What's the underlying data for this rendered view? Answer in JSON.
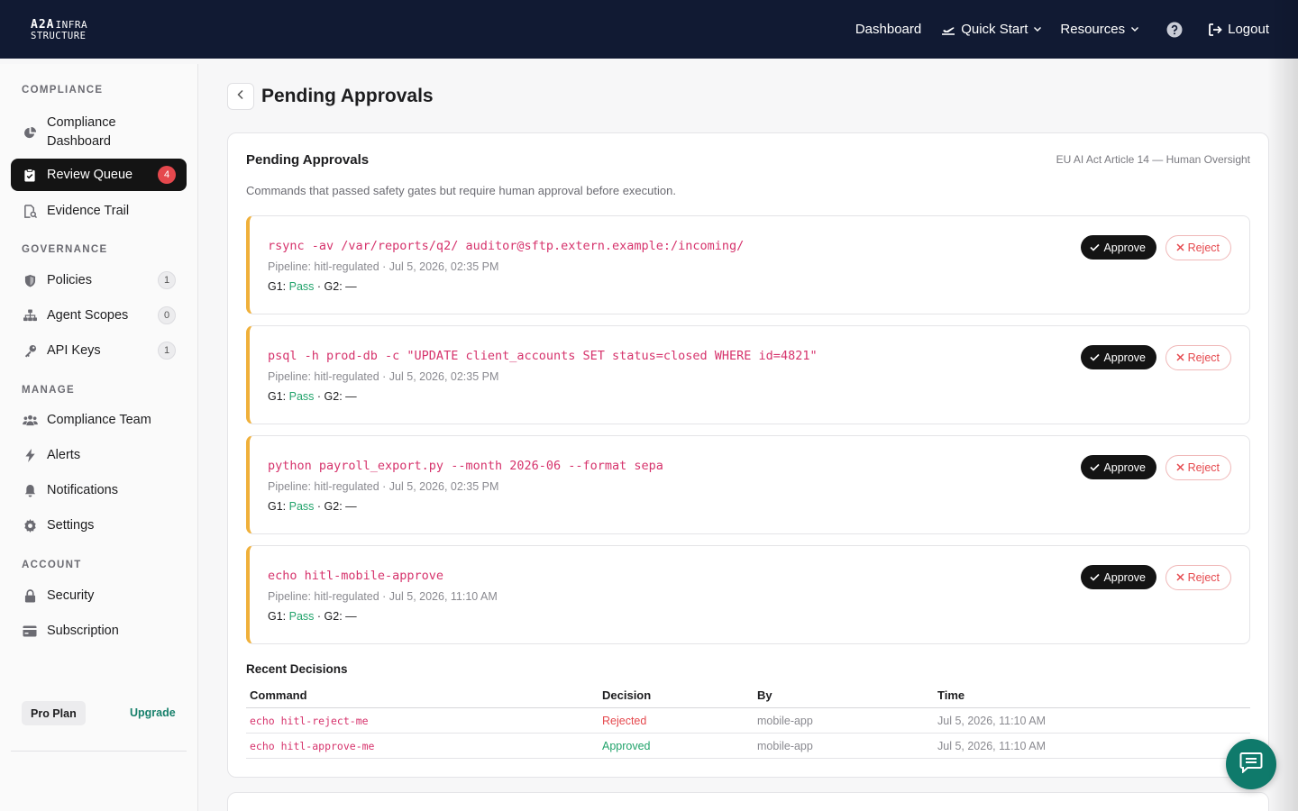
{
  "brand": {
    "line1": "A2A",
    "line1_small": "INFRA",
    "line2": "STRUCTURE"
  },
  "nav": {
    "dashboard": "Dashboard",
    "quick_start": "Quick Start",
    "resources": "Resources",
    "logout": "Logout"
  },
  "sidebar": {
    "compliance_title": "COMPLIANCE",
    "governance_title": "GOVERNANCE",
    "manage_title": "MANAGE",
    "account_title": "ACCOUNT",
    "items": {
      "compliance_dashboard_1": "Compliance",
      "compliance_dashboard_2": "Dashboard",
      "review_queue": "Review Queue",
      "review_queue_count": "4",
      "evidence_trail": "Evidence Trail",
      "policies": "Policies",
      "policies_count": "1",
      "agent_scopes": "Agent Scopes",
      "agent_scopes_count": "0",
      "api_keys": "API Keys",
      "api_keys_count": "1",
      "compliance_team": "Compliance Team",
      "alerts": "Alerts",
      "notifications": "Notifications",
      "settings": "Settings",
      "security": "Security",
      "subscription": "Subscription"
    },
    "plan": "Pro Plan",
    "upgrade": "Upgrade"
  },
  "page": {
    "title": "Pending Approvals"
  },
  "card": {
    "title": "Pending Approvals",
    "tag": "EU AI Act Article 14 — Human Oversight",
    "description": "Commands that passed safety gates but require human approval before execution."
  },
  "approvals": [
    {
      "command": "rsync -av /var/reports/q2/ auditor@sftp.extern.example:/incoming/",
      "meta": "Pipeline: hitl-regulated · Jul 5, 2026, 02:35 PM",
      "g1_label": "G1:",
      "g1_value": "Pass",
      "g2": "· G2: —"
    },
    {
      "command": "psql -h prod-db -c \"UPDATE client_accounts SET status=closed WHERE id=4821\"",
      "meta": "Pipeline: hitl-regulated · Jul 5, 2026, 02:35 PM",
      "g1_label": "G1:",
      "g1_value": "Pass",
      "g2": "· G2: —"
    },
    {
      "command": "python payroll_export.py --month 2026-06 --format sepa",
      "meta": "Pipeline: hitl-regulated · Jul 5, 2026, 02:35 PM",
      "g1_label": "G1:",
      "g1_value": "Pass",
      "g2": "· G2: —"
    },
    {
      "command": "echo hitl-mobile-approve",
      "meta": "Pipeline: hitl-regulated · Jul 5, 2026, 11:10 AM",
      "g1_label": "G1:",
      "g1_value": "Pass",
      "g2": "· G2: —"
    }
  ],
  "buttons": {
    "approve": "Approve",
    "reject": "Reject"
  },
  "recent": {
    "title": "Recent Decisions",
    "headers": [
      "Command",
      "Decision",
      "By",
      "Time"
    ],
    "rows": [
      {
        "command": "echo hitl-reject-me",
        "decision": "Rejected",
        "by": "mobile-app",
        "time": "Jul 5, 2026, 11:10 AM"
      },
      {
        "command": "echo hitl-approve-me",
        "decision": "Approved",
        "by": "mobile-app",
        "time": "Jul 5, 2026, 11:10 AM"
      }
    ]
  },
  "colors": {
    "topbar": "#111a33",
    "accent": "#0f7a6b",
    "command": "#d6336c",
    "pending_border": "#f0b03a",
    "pass": "#22a36b",
    "reject": "#e5484d"
  }
}
